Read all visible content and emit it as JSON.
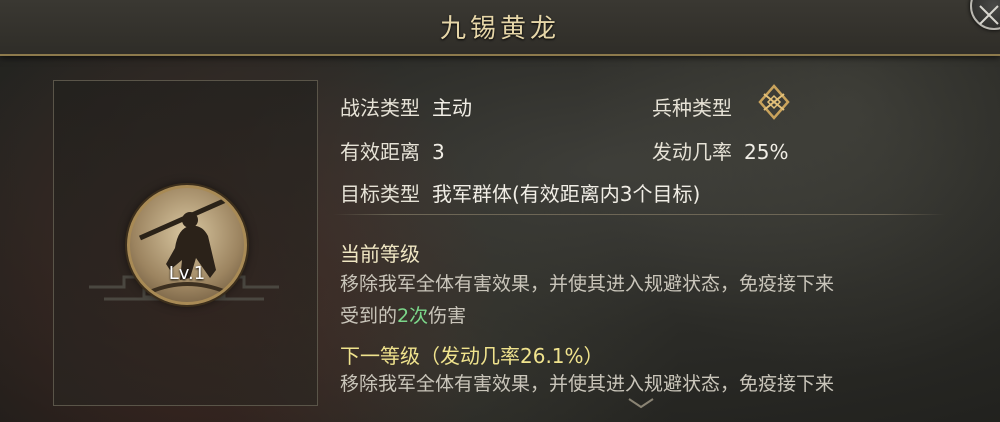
{
  "title": "九锡黄龙",
  "skill": {
    "level_label": "Lv.1",
    "icon": "warrior-spear-icon"
  },
  "info": {
    "tactic_type_label": "战法类型",
    "tactic_type_value": "主动",
    "troop_type_label": "兵种类型",
    "troop_type_icon": "troop-type-icon",
    "range_label": "有效距离",
    "range_value": "3",
    "rate_label": "发动几率",
    "rate_value": "25%",
    "target_label": "目标类型",
    "target_value": "我军群体(有效距离内3个目标)"
  },
  "current": {
    "title": "当前等级",
    "desc_line1": "移除我军全体有害效果，并使其进入规避状态，免疫接下来",
    "desc_line2_prefix": "受到的",
    "desc_line2_highlight": "2次",
    "desc_line2_suffix": "伤害"
  },
  "next": {
    "title": "下一等级（发动几率26.1%）",
    "desc_line1": "移除我军全体有害效果，并使其进入规避状态，免疫接下来"
  },
  "colors": {
    "highlight_green": "#7cd78a",
    "next_yellow": "#f0e38d",
    "title_gold": "#e6d6a8"
  }
}
